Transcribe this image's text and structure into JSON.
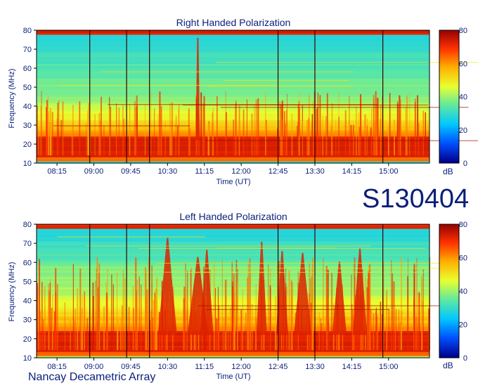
{
  "colors": {
    "text": "#0a1f7a",
    "colormap": [
      "#00008f",
      "#0050ff",
      "#00c8ff",
      "#60e8a0",
      "#e8ff30",
      "#ffb000",
      "#ff3000",
      "#8f0000"
    ]
  },
  "dataset_id": "S130404",
  "instrument": "Nancay Decametric Array",
  "chart_data": [
    {
      "type": "heatmap",
      "title": "Right Handed Polarization",
      "xlabel": "Time (UT)",
      "ylabel": "Frequency (MHz)",
      "xticks": [
        "08:15",
        "09:00",
        "09:45",
        "10:30",
        "11:15",
        "12:00",
        "12:45",
        "13:30",
        "14:15",
        "15:00"
      ],
      "yticks": [
        10,
        20,
        30,
        40,
        50,
        60,
        70,
        80
      ],
      "ylim": [
        10,
        80
      ],
      "colorbar": {
        "label": "dB",
        "range": [
          0,
          80
        ],
        "ticks": [
          0,
          20,
          40,
          60,
          80
        ]
      },
      "xlim": [
        "07:50",
        "15:50"
      ],
      "event_lines": [
        "08:55",
        "09:40",
        "10:08",
        "12:45",
        "13:30",
        "14:53"
      ],
      "burst_times": [
        "11:07"
      ],
      "profile": "right"
    },
    {
      "type": "heatmap",
      "title": "Left Handed Polarization",
      "xlabel": "Time (UT)",
      "ylabel": "Frequency (MHz)",
      "xticks": [
        "08:15",
        "09:00",
        "09:45",
        "10:30",
        "11:15",
        "12:00",
        "12:45",
        "13:30",
        "14:15",
        "15:00"
      ],
      "yticks": [
        10,
        20,
        30,
        40,
        50,
        60,
        70,
        80
      ],
      "ylim": [
        10,
        80
      ],
      "colorbar": {
        "label": "dB",
        "range": [
          0,
          80
        ],
        "ticks": [
          0,
          20,
          40,
          60,
          80
        ]
      },
      "xlim": [
        "07:50",
        "15:50"
      ],
      "event_lines": [
        "08:55",
        "09:40",
        "10:08",
        "12:45",
        "13:30",
        "14:53"
      ],
      "burst_times": [
        "10:30",
        "11:07",
        "11:18",
        "12:25",
        "12:50",
        "13:15",
        "14:00",
        "14:25"
      ],
      "profile": "left"
    }
  ]
}
